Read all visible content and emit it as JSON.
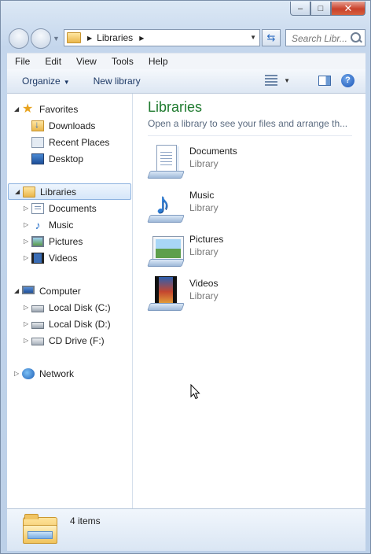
{
  "window": {
    "caption_buttons": {
      "minimize": "–",
      "maximize": "□",
      "close": "✕"
    }
  },
  "address": {
    "crumb": "Libraries",
    "search_placeholder": "Search Libr..."
  },
  "menu": [
    "File",
    "Edit",
    "View",
    "Tools",
    "Help"
  ],
  "toolbar": {
    "organize": "Organize",
    "new_library": "New library",
    "help": "?"
  },
  "nav": {
    "favorites": {
      "label": "Favorites",
      "items": [
        "Downloads",
        "Recent Places",
        "Desktop"
      ]
    },
    "libraries": {
      "label": "Libraries",
      "items": [
        "Documents",
        "Music",
        "Pictures",
        "Videos"
      ]
    },
    "computer": {
      "label": "Computer",
      "items": [
        "Local Disk (C:)",
        "Local Disk (D:)",
        "CD Drive (F:)"
      ]
    },
    "network": {
      "label": "Network"
    }
  },
  "content": {
    "title": "Libraries",
    "subtitle": "Open a library to see your files and arrange th...",
    "libraries": [
      {
        "name": "Documents",
        "type": "Library",
        "icon": "documents-library-icon"
      },
      {
        "name": "Music",
        "type": "Library",
        "icon": "music-library-icon"
      },
      {
        "name": "Pictures",
        "type": "Library",
        "icon": "pictures-library-icon"
      },
      {
        "name": "Videos",
        "type": "Library",
        "icon": "videos-library-icon"
      }
    ]
  },
  "status": {
    "count": "4 items"
  },
  "colors": {
    "title_green": "#1e7a2e",
    "chrome_blue": "#c4d6ec",
    "selection": "#d5e6f9"
  }
}
